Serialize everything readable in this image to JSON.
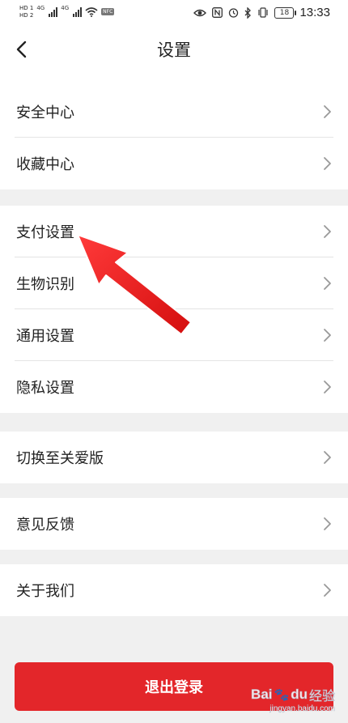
{
  "status_bar": {
    "hd1": "HD 1",
    "hd2": "HD 2",
    "net1": "4G",
    "net2": "4G",
    "extra": "NFC",
    "icons": [
      "eye-icon",
      "nfc-icon",
      "alarm-icon",
      "bluetooth-icon",
      "vibrate-icon"
    ],
    "battery": "18",
    "time": "13:33"
  },
  "header": {
    "title": "设置",
    "back_icon": "chevron-left-icon"
  },
  "groups": [
    {
      "items": [
        {
          "label": "安全中心"
        },
        {
          "label": "收藏中心"
        }
      ]
    },
    {
      "items": [
        {
          "label": "支付设置"
        },
        {
          "label": "生物识别"
        },
        {
          "label": "通用设置"
        },
        {
          "label": "隐私设置"
        }
      ]
    },
    {
      "items": [
        {
          "label": "切换至关爱版"
        }
      ]
    },
    {
      "items": [
        {
          "label": "意见反馈"
        }
      ]
    },
    {
      "items": [
        {
          "label": "关于我们"
        }
      ]
    }
  ],
  "logout": {
    "label": "退出登录"
  },
  "watermark": {
    "brand": "Bai",
    "brand2": "du",
    "suffix": "经验",
    "url": "jingyan.baidu.com"
  },
  "colors": {
    "accent": "#e3262a",
    "page_bg": "#f0f0f0",
    "arrow": "#ee1c1c"
  }
}
